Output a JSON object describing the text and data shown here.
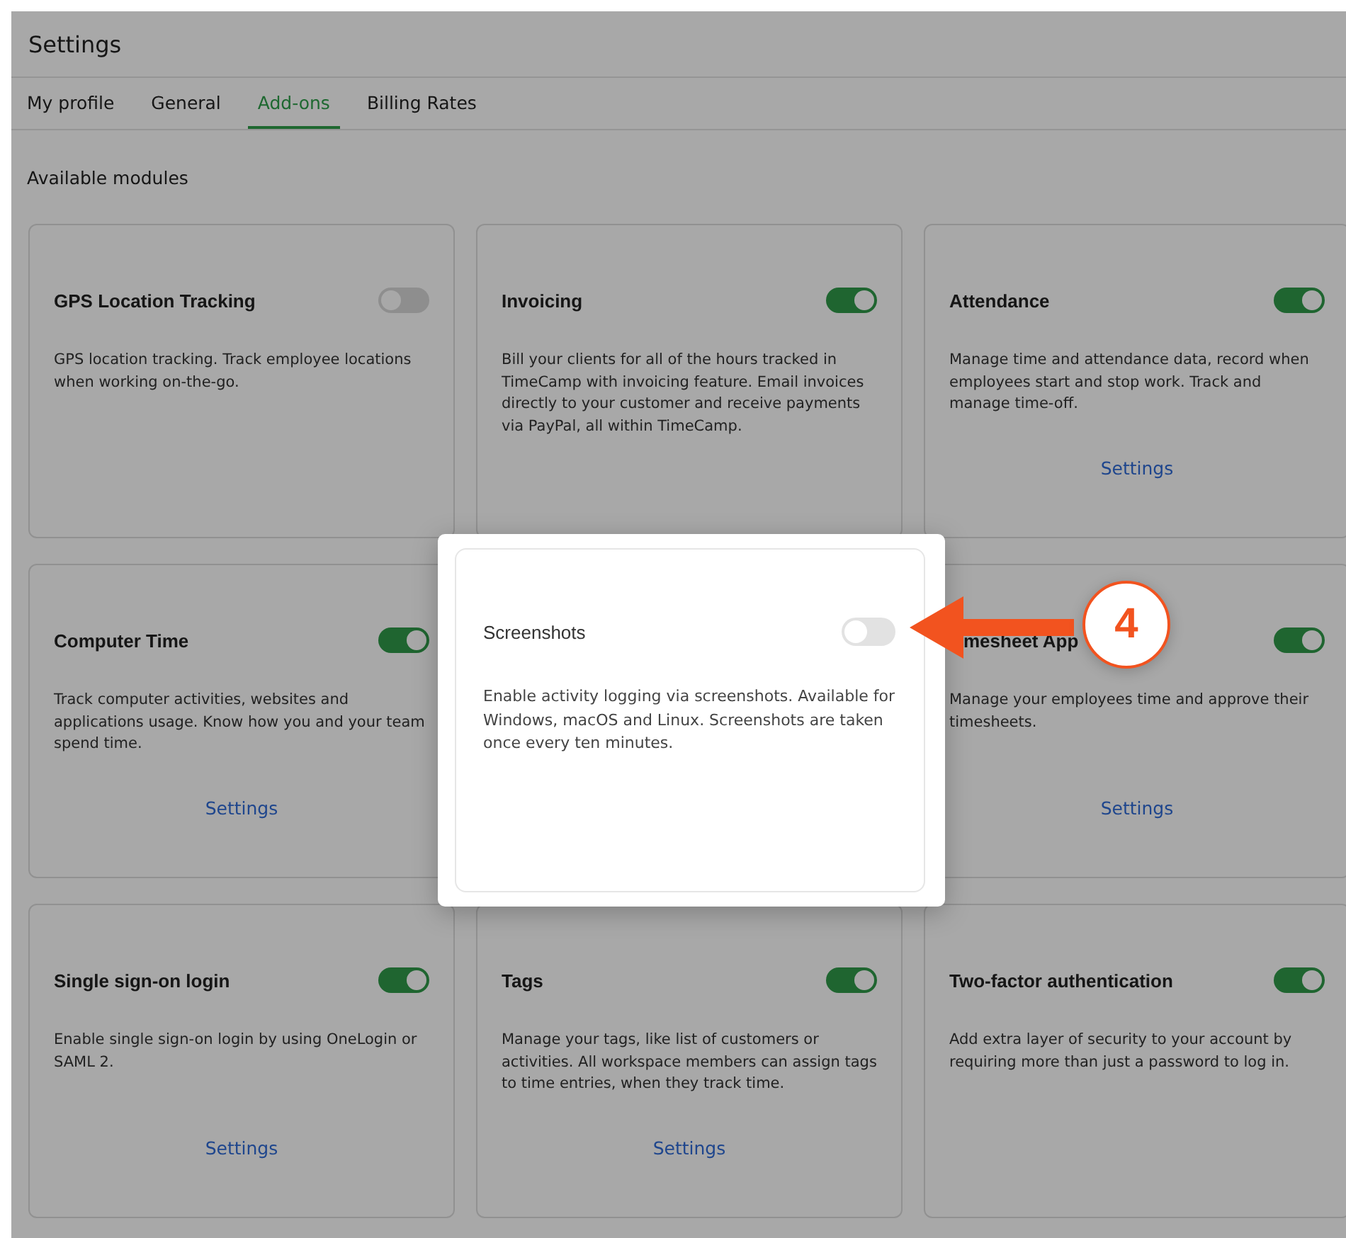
{
  "window": {
    "title": "Settings"
  },
  "tabs": [
    {
      "label": "My profile",
      "selected": false
    },
    {
      "label": "General",
      "selected": false
    },
    {
      "label": "Add-ons",
      "selected": true
    },
    {
      "label": "Billing Rates",
      "selected": false
    }
  ],
  "section_title": "Available modules",
  "modules": [
    {
      "title": "GPS Location Tracking",
      "enabled": false,
      "description": "GPS location tracking. Track employee locations when working on-the-go."
    },
    {
      "title": "Invoicing",
      "enabled": true,
      "description": "Bill your clients for all of the hours tracked in TimeCamp with invoicing feature. Email invoices directly to your customer and receive payments via PayPal, all within TimeCamp."
    },
    {
      "title": "Attendance",
      "enabled": true,
      "description": "Manage time and attendance data, record when employees start and stop work. Track and manage time-off.",
      "settings_link": "Settings"
    },
    {
      "title": "Computer Time",
      "enabled": true,
      "description": "Track computer activities, websites and applications usage. Know how you and your team spend time.",
      "settings_link": "Settings"
    },
    {
      "title": "mesheet App",
      "enabled": true,
      "description": "Manage your employees time and approve their timesheets.",
      "settings_link": "Settings"
    },
    {
      "title": "Single sign-on login",
      "enabled": true,
      "description": "Enable single sign-on login by using OneLogin or SAML 2.",
      "settings_link": "Settings"
    },
    {
      "title": "Tags",
      "enabled": true,
      "description": "Manage your tags, like list of customers or activities. All workspace members can assign tags to time entries, when they track time.",
      "settings_link": "Settings"
    },
    {
      "title": "Two-factor authentication",
      "enabled": true,
      "description": "Add extra layer of security to your account by requiring more than just a password to log in."
    }
  ],
  "modal": {
    "title": "Screenshots",
    "enabled": false,
    "description": "Enable activity logging via screenshots. Available for Windows, macOS and Linux. Screenshots are taken once every ten minutes."
  },
  "annotation": {
    "label": "4"
  }
}
